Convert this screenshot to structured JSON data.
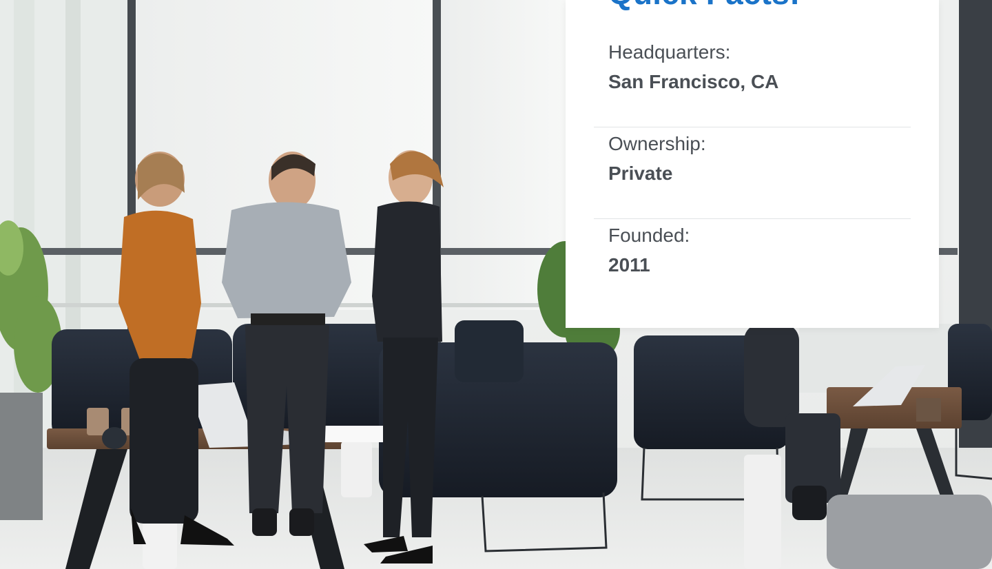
{
  "quick_facts": {
    "title": "Quick Facts:",
    "accent_color": "#1a73c8",
    "items": [
      {
        "label": "Headquarters:",
        "value": "San Francisco, CA"
      },
      {
        "label": "Ownership:",
        "value": "Private"
      },
      {
        "label": "Founded:",
        "value": "2011"
      }
    ]
  },
  "background": {
    "description_icon": "office-photo"
  }
}
